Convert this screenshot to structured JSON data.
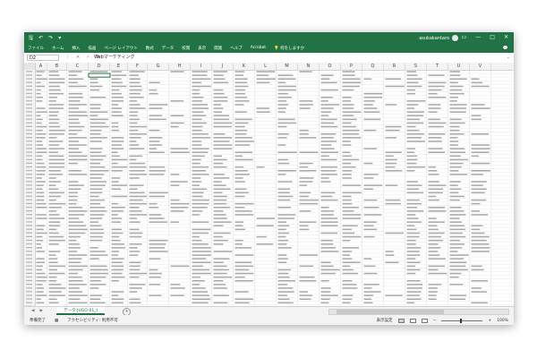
{
  "title_bar": {
    "qat_icons": [
      "save-icon",
      "undo-icon",
      "redo-icon",
      "quick-access-dropdown-icon"
    ],
    "user_name": "asukakantaro",
    "window_controls": [
      "minimize-icon",
      "restore-icon",
      "close-icon"
    ]
  },
  "ribbon": {
    "tabs": [
      "ファイル",
      "ホーム",
      "挿入",
      "描画",
      "ページ レイアウト",
      "数式",
      "データ",
      "校閲",
      "表示",
      "開発",
      "ヘルプ",
      "Acrobat",
      "何をしますか"
    ],
    "share_icon": "comment-icon"
  },
  "formula_bar": {
    "name_box": "D2",
    "tools": [
      "⋮",
      "✕",
      "✓",
      "fx"
    ],
    "value": "Webマーケティング"
  },
  "columns": [
    "A",
    "B",
    "C",
    "D",
    "E",
    "F",
    "G",
    "H",
    "I",
    "J",
    "K",
    "L",
    "M",
    "N",
    "O",
    "P",
    "Q",
    "R",
    "S",
    "T",
    "U",
    "V"
  ],
  "sheet_bar": {
    "nav": [
      "◀",
      "▶"
    ],
    "sheet_tab": "データ-JUGO-01_t",
    "add_sheet": "+"
  },
  "status_bar": {
    "ready": "準備完了",
    "accessibility": "アクセシビリティ: 利用不可",
    "display_settings": "表示設定",
    "zoom_out": "−",
    "zoom_in": "+",
    "zoom": "100%"
  },
  "colors": {
    "accent": "#217346",
    "grid_line": "#e4e4e4",
    "text_gray": "#8a8a8a"
  }
}
